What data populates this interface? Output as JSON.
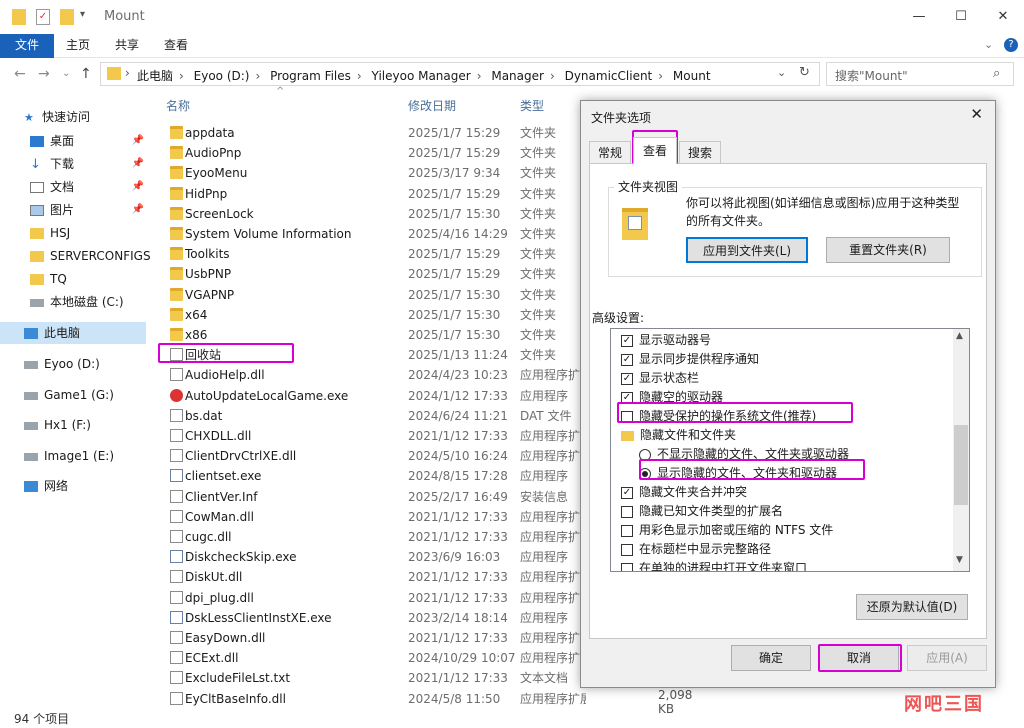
{
  "window": {
    "title": "Mount"
  },
  "ribbon": {
    "tabs": [
      "文件",
      "主页",
      "共享",
      "查看"
    ]
  },
  "address": {
    "crumbs": [
      "此电脑",
      "Eyoo (D:)",
      "Program Files",
      "Yileyoo Manager",
      "Manager",
      "DynamicClient",
      "Mount"
    ],
    "search_placeholder": "搜索\"Mount\""
  },
  "nav": {
    "items": [
      {
        "label": "快速访问",
        "icon": "star-icon",
        "pinned": false
      },
      {
        "label": "桌面",
        "icon": "desktop-icon",
        "pinned": true
      },
      {
        "label": "下载",
        "icon": "download-icon",
        "pinned": true
      },
      {
        "label": "文档",
        "icon": "document-icon",
        "pinned": true
      },
      {
        "label": "图片",
        "icon": "picture-icon",
        "pinned": true
      },
      {
        "label": "HSJ",
        "icon": "folder-icon",
        "pinned": false
      },
      {
        "label": "SERVERCONFIGS$",
        "icon": "folder-icon",
        "pinned": false
      },
      {
        "label": "TQ",
        "icon": "folder-icon",
        "pinned": false
      },
      {
        "label": "本地磁盘 (C:)",
        "icon": "drive-icon",
        "pinned": false
      },
      {
        "label": "此电脑",
        "icon": "computer-icon",
        "pinned": false
      },
      {
        "label": "Eyoo (D:)",
        "icon": "drive-icon",
        "pinned": false
      },
      {
        "label": "Game1 (G:)",
        "icon": "drive-icon",
        "pinned": false
      },
      {
        "label": "Hx1 (F:)",
        "icon": "drive-icon",
        "pinned": false
      },
      {
        "label": "Image1 (E:)",
        "icon": "drive-icon",
        "pinned": false
      },
      {
        "label": "网络",
        "icon": "network-icon",
        "pinned": false
      }
    ]
  },
  "list": {
    "headers": {
      "name": "名称",
      "date": "修改日期",
      "type": "类型"
    },
    "rows": [
      {
        "name": "appdata",
        "date": "2025/1/7 15:29",
        "type": "文件夹",
        "kind": "folder"
      },
      {
        "name": "AudioPnp",
        "date": "2025/1/7 15:29",
        "type": "文件夹",
        "kind": "folder"
      },
      {
        "name": "EyooMenu",
        "date": "2025/3/17 9:34",
        "type": "文件夹",
        "kind": "folder"
      },
      {
        "name": "HidPnp",
        "date": "2025/1/7 15:29",
        "type": "文件夹",
        "kind": "folder"
      },
      {
        "name": "ScreenLock",
        "date": "2025/1/7 15:30",
        "type": "文件夹",
        "kind": "folder"
      },
      {
        "name": "System Volume Information",
        "date": "2025/4/16 14:29",
        "type": "文件夹",
        "kind": "folder"
      },
      {
        "name": "Toolkits",
        "date": "2025/1/7 15:29",
        "type": "文件夹",
        "kind": "folder"
      },
      {
        "name": "UsbPNP",
        "date": "2025/1/7 15:29",
        "type": "文件夹",
        "kind": "folder"
      },
      {
        "name": "VGAPNP",
        "date": "2025/1/7 15:30",
        "type": "文件夹",
        "kind": "folder"
      },
      {
        "name": "x64",
        "date": "2025/1/7 15:30",
        "type": "文件夹",
        "kind": "folder"
      },
      {
        "name": "x86",
        "date": "2025/1/7 15:30",
        "type": "文件夹",
        "kind": "folder"
      },
      {
        "name": "回收站",
        "date": "2025/1/13 11:24",
        "type": "文件夹",
        "kind": "recycle"
      },
      {
        "name": "AudioHelp.dll",
        "date": "2024/4/23 10:23",
        "type": "应用程序扩展",
        "kind": "file"
      },
      {
        "name": "AutoUpdateLocalGame.exe",
        "date": "2024/1/12 17:33",
        "type": "应用程序",
        "kind": "red-exe"
      },
      {
        "name": "bs.dat",
        "date": "2024/6/24 11:21",
        "type": "DAT 文件",
        "kind": "file"
      },
      {
        "name": "CHXDLL.dll",
        "date": "2021/1/12 17:33",
        "type": "应用程序扩展",
        "kind": "file"
      },
      {
        "name": "ClientDrvCtrlXE.dll",
        "date": "2024/5/10 16:24",
        "type": "应用程序扩展",
        "kind": "file"
      },
      {
        "name": "clientset.exe",
        "date": "2024/8/15 17:28",
        "type": "应用程序",
        "kind": "exe"
      },
      {
        "name": "ClientVer.Inf",
        "date": "2025/2/17 16:49",
        "type": "安装信息",
        "kind": "file"
      },
      {
        "name": "CowMan.dll",
        "date": "2021/1/12 17:33",
        "type": "应用程序扩展",
        "kind": "file"
      },
      {
        "name": "cugc.dll",
        "date": "2021/1/12 17:33",
        "type": "应用程序扩展",
        "kind": "file"
      },
      {
        "name": "DiskcheckSkip.exe",
        "date": "2023/6/9 16:03",
        "type": "应用程序",
        "kind": "exe"
      },
      {
        "name": "DiskUt.dll",
        "date": "2021/1/12 17:33",
        "type": "应用程序扩展",
        "kind": "file"
      },
      {
        "name": "dpi_plug.dll",
        "date": "2021/1/12 17:33",
        "type": "应用程序扩展",
        "kind": "file"
      },
      {
        "name": "DskLessClientInstXE.exe",
        "date": "2023/2/14 18:14",
        "type": "应用程序",
        "kind": "exe"
      },
      {
        "name": "EasyDown.dll",
        "date": "2021/1/12 17:33",
        "type": "应用程序扩展",
        "kind": "file"
      },
      {
        "name": "ECExt.dll",
        "date": "2024/10/29 10:07",
        "type": "应用程序扩展",
        "kind": "file"
      },
      {
        "name": "ExcludeFileLst.txt",
        "date": "2021/1/12 17:33",
        "type": "文本文档",
        "kind": "file"
      },
      {
        "name": "EyCltBaseInfo.dll",
        "date": "2024/5/8 11:50",
        "type": "应用程序扩展",
        "kind": "file",
        "size": "2,098 KB"
      }
    ]
  },
  "status": {
    "count": "94 个项目"
  },
  "dialog": {
    "title": "文件夹选项",
    "tabs": [
      "常规",
      "查看",
      "搜索"
    ],
    "active_tab": "查看",
    "folder_view": {
      "legend": "文件夹视图",
      "description": "你可以将此视图(如详细信息或图标)应用于这种类型的所有文件夹。",
      "apply_button": "应用到文件夹(L)",
      "reset_button": "重置文件夹(R)"
    },
    "advanced_label": "高级设置:",
    "options": [
      {
        "kind": "checkbox",
        "label": "显示驱动器号",
        "checked": true,
        "indent": 0
      },
      {
        "kind": "checkbox",
        "label": "显示同步提供程序通知",
        "checked": true,
        "indent": 0
      },
      {
        "kind": "checkbox",
        "label": "显示状态栏",
        "checked": true,
        "indent": 0
      },
      {
        "kind": "checkbox",
        "label": "隐藏空的驱动器",
        "checked": true,
        "indent": 0
      },
      {
        "kind": "checkbox",
        "label": "隐藏受保护的操作系统文件(推荐)",
        "checked": false,
        "indent": 0
      },
      {
        "kind": "folder",
        "label": "隐藏文件和文件夹",
        "indent": 0
      },
      {
        "kind": "radio",
        "label": "不显示隐藏的文件、文件夹或驱动器",
        "checked": false,
        "indent": 1
      },
      {
        "kind": "radio",
        "label": "显示隐藏的文件、文件夹和驱动器",
        "checked": true,
        "indent": 1
      },
      {
        "kind": "checkbox",
        "label": "隐藏文件夹合并冲突",
        "checked": true,
        "indent": 0
      },
      {
        "kind": "checkbox",
        "label": "隐藏已知文件类型的扩展名",
        "checked": false,
        "indent": 0
      },
      {
        "kind": "checkbox",
        "label": "用彩色显示加密或压缩的 NTFS 文件",
        "checked": false,
        "indent": 0
      },
      {
        "kind": "checkbox",
        "label": "在标题栏中显示完整路径",
        "checked": false,
        "indent": 0
      },
      {
        "kind": "checkbox",
        "label": "在单独的进程中打开文件夹窗口",
        "checked": false,
        "indent": 0
      }
    ],
    "restore_button": "还原为默认值(D)",
    "ok_button": "确定",
    "cancel_button": "取消",
    "apply_button": "应用(A)"
  },
  "watermark": "网吧三国"
}
